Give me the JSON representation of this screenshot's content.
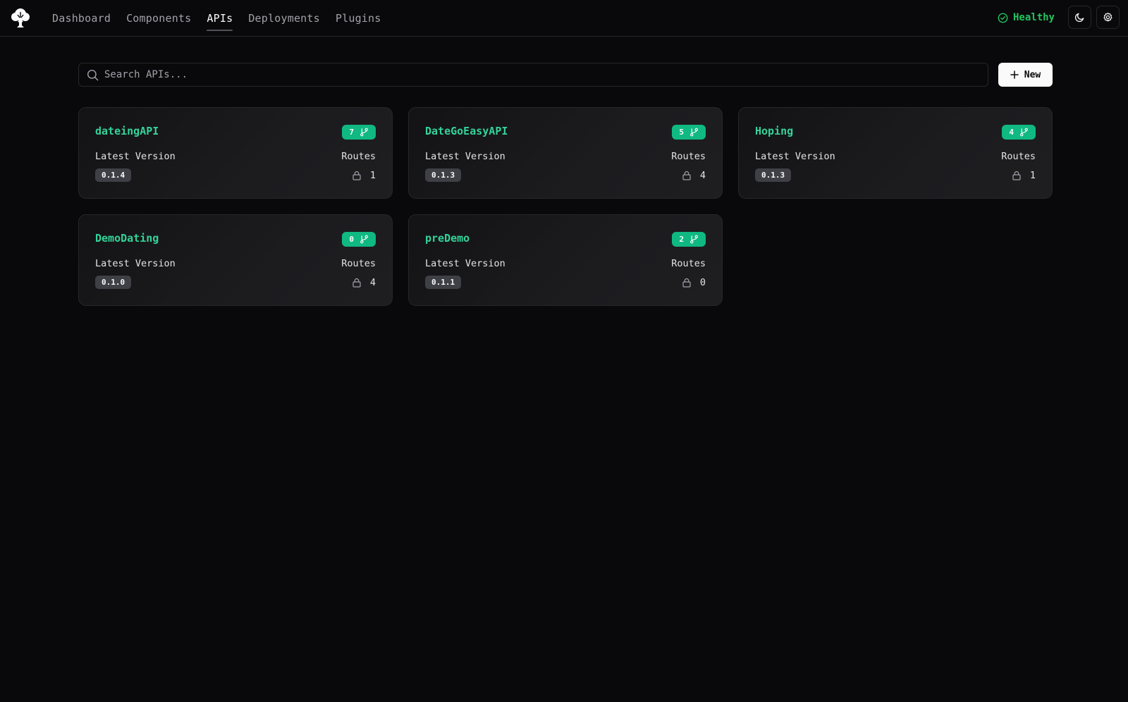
{
  "nav": {
    "items": [
      {
        "label": "Dashboard",
        "active": false
      },
      {
        "label": "Components",
        "active": false
      },
      {
        "label": "APIs",
        "active": true
      },
      {
        "label": "Deployments",
        "active": false
      },
      {
        "label": "Plugins",
        "active": false
      }
    ]
  },
  "status": {
    "label": "Healthy",
    "color": "#22c55e"
  },
  "search": {
    "placeholder": "Search APIs...",
    "value": ""
  },
  "toolbar": {
    "new_label": "New"
  },
  "card_labels": {
    "version_label": "Latest Version",
    "routes_label": "Routes"
  },
  "apis": [
    {
      "name": "dateingAPI",
      "versions": "7",
      "latest_version": "0.1.4",
      "routes": "1"
    },
    {
      "name": "DateGoEasyAPI",
      "versions": "5",
      "latest_version": "0.1.3",
      "routes": "4"
    },
    {
      "name": "Hoping",
      "versions": "4",
      "latest_version": "0.1.3",
      "routes": "1"
    },
    {
      "name": "DemoDating",
      "versions": "0",
      "latest_version": "0.1.0",
      "routes": "4"
    },
    {
      "name": "preDemo",
      "versions": "2",
      "latest_version": "0.1.1",
      "routes": "0"
    }
  ],
  "icons": {
    "logo": "tree-logo-icon",
    "status": "check-circle-icon",
    "theme": "moon-icon",
    "settings": "gear-icon",
    "search": "search-icon",
    "new": "plus-icon",
    "badge": "git-branch-icon",
    "routes": "lock-icon"
  },
  "colors": {
    "accent": "#34d399",
    "badge_bg": "#10b981",
    "background": "#09090b"
  }
}
